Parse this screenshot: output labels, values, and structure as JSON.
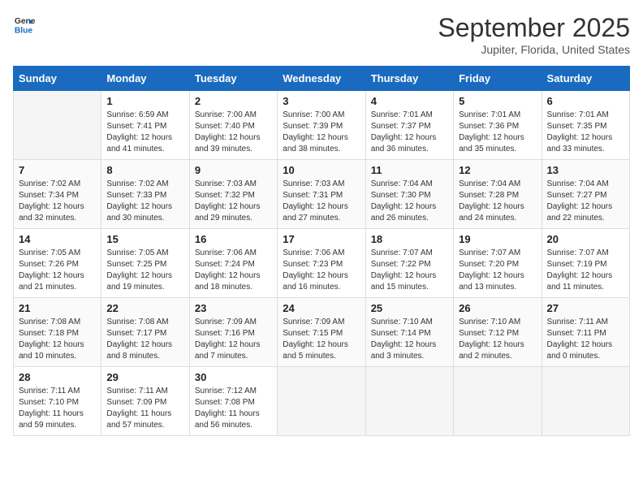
{
  "logo": {
    "line1": "General",
    "line2": "Blue"
  },
  "title": "September 2025",
  "location": "Jupiter, Florida, United States",
  "weekdays": [
    "Sunday",
    "Monday",
    "Tuesday",
    "Wednesday",
    "Thursday",
    "Friday",
    "Saturday"
  ],
  "weeks": [
    [
      {
        "day": "",
        "info": ""
      },
      {
        "day": "1",
        "info": "Sunrise: 6:59 AM\nSunset: 7:41 PM\nDaylight: 12 hours\nand 41 minutes."
      },
      {
        "day": "2",
        "info": "Sunrise: 7:00 AM\nSunset: 7:40 PM\nDaylight: 12 hours\nand 39 minutes."
      },
      {
        "day": "3",
        "info": "Sunrise: 7:00 AM\nSunset: 7:39 PM\nDaylight: 12 hours\nand 38 minutes."
      },
      {
        "day": "4",
        "info": "Sunrise: 7:01 AM\nSunset: 7:37 PM\nDaylight: 12 hours\nand 36 minutes."
      },
      {
        "day": "5",
        "info": "Sunrise: 7:01 AM\nSunset: 7:36 PM\nDaylight: 12 hours\nand 35 minutes."
      },
      {
        "day": "6",
        "info": "Sunrise: 7:01 AM\nSunset: 7:35 PM\nDaylight: 12 hours\nand 33 minutes."
      }
    ],
    [
      {
        "day": "7",
        "info": "Sunrise: 7:02 AM\nSunset: 7:34 PM\nDaylight: 12 hours\nand 32 minutes."
      },
      {
        "day": "8",
        "info": "Sunrise: 7:02 AM\nSunset: 7:33 PM\nDaylight: 12 hours\nand 30 minutes."
      },
      {
        "day": "9",
        "info": "Sunrise: 7:03 AM\nSunset: 7:32 PM\nDaylight: 12 hours\nand 29 minutes."
      },
      {
        "day": "10",
        "info": "Sunrise: 7:03 AM\nSunset: 7:31 PM\nDaylight: 12 hours\nand 27 minutes."
      },
      {
        "day": "11",
        "info": "Sunrise: 7:04 AM\nSunset: 7:30 PM\nDaylight: 12 hours\nand 26 minutes."
      },
      {
        "day": "12",
        "info": "Sunrise: 7:04 AM\nSunset: 7:28 PM\nDaylight: 12 hours\nand 24 minutes."
      },
      {
        "day": "13",
        "info": "Sunrise: 7:04 AM\nSunset: 7:27 PM\nDaylight: 12 hours\nand 22 minutes."
      }
    ],
    [
      {
        "day": "14",
        "info": "Sunrise: 7:05 AM\nSunset: 7:26 PM\nDaylight: 12 hours\nand 21 minutes."
      },
      {
        "day": "15",
        "info": "Sunrise: 7:05 AM\nSunset: 7:25 PM\nDaylight: 12 hours\nand 19 minutes."
      },
      {
        "day": "16",
        "info": "Sunrise: 7:06 AM\nSunset: 7:24 PM\nDaylight: 12 hours\nand 18 minutes."
      },
      {
        "day": "17",
        "info": "Sunrise: 7:06 AM\nSunset: 7:23 PM\nDaylight: 12 hours\nand 16 minutes."
      },
      {
        "day": "18",
        "info": "Sunrise: 7:07 AM\nSunset: 7:22 PM\nDaylight: 12 hours\nand 15 minutes."
      },
      {
        "day": "19",
        "info": "Sunrise: 7:07 AM\nSunset: 7:20 PM\nDaylight: 12 hours\nand 13 minutes."
      },
      {
        "day": "20",
        "info": "Sunrise: 7:07 AM\nSunset: 7:19 PM\nDaylight: 12 hours\nand 11 minutes."
      }
    ],
    [
      {
        "day": "21",
        "info": "Sunrise: 7:08 AM\nSunset: 7:18 PM\nDaylight: 12 hours\nand 10 minutes."
      },
      {
        "day": "22",
        "info": "Sunrise: 7:08 AM\nSunset: 7:17 PM\nDaylight: 12 hours\nand 8 minutes."
      },
      {
        "day": "23",
        "info": "Sunrise: 7:09 AM\nSunset: 7:16 PM\nDaylight: 12 hours\nand 7 minutes."
      },
      {
        "day": "24",
        "info": "Sunrise: 7:09 AM\nSunset: 7:15 PM\nDaylight: 12 hours\nand 5 minutes."
      },
      {
        "day": "25",
        "info": "Sunrise: 7:10 AM\nSunset: 7:14 PM\nDaylight: 12 hours\nand 3 minutes."
      },
      {
        "day": "26",
        "info": "Sunrise: 7:10 AM\nSunset: 7:12 PM\nDaylight: 12 hours\nand 2 minutes."
      },
      {
        "day": "27",
        "info": "Sunrise: 7:11 AM\nSunset: 7:11 PM\nDaylight: 12 hours\nand 0 minutes."
      }
    ],
    [
      {
        "day": "28",
        "info": "Sunrise: 7:11 AM\nSunset: 7:10 PM\nDaylight: 11 hours\nand 59 minutes."
      },
      {
        "day": "29",
        "info": "Sunrise: 7:11 AM\nSunset: 7:09 PM\nDaylight: 11 hours\nand 57 minutes."
      },
      {
        "day": "30",
        "info": "Sunrise: 7:12 AM\nSunset: 7:08 PM\nDaylight: 11 hours\nand 56 minutes."
      },
      {
        "day": "",
        "info": ""
      },
      {
        "day": "",
        "info": ""
      },
      {
        "day": "",
        "info": ""
      },
      {
        "day": "",
        "info": ""
      }
    ]
  ]
}
